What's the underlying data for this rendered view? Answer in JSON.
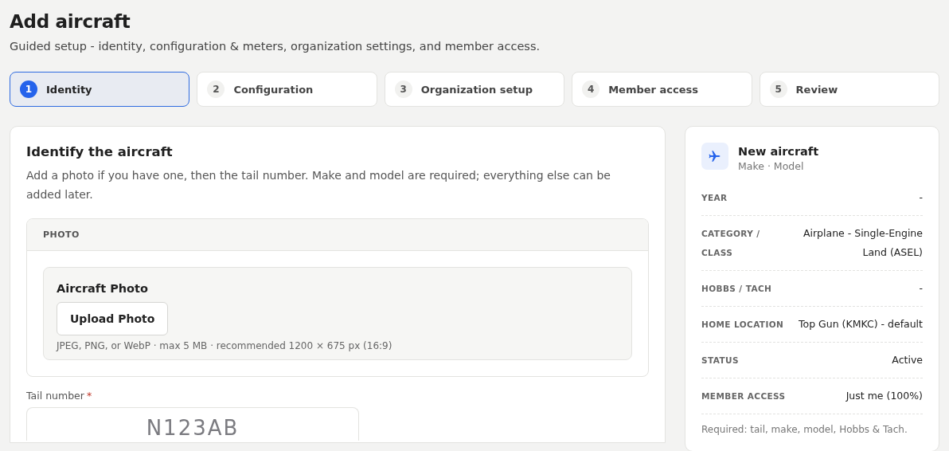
{
  "header": {
    "title": "Add aircraft",
    "subtitle": "Guided setup - identity, configuration & meters, organization settings, and member access."
  },
  "steps": [
    {
      "number": "1",
      "label": "Identity",
      "selected": true
    },
    {
      "number": "2",
      "label": "Configuration",
      "selected": false
    },
    {
      "number": "3",
      "label": "Organization setup",
      "selected": false
    },
    {
      "number": "4",
      "label": "Member access",
      "selected": false
    },
    {
      "number": "5",
      "label": "Review",
      "selected": false
    }
  ],
  "identity": {
    "title": "Identify the aircraft",
    "description": "Add a photo if you have one, then the tail number. Make and model are required; everything else can be added later.",
    "photo_section": {
      "heading": "PHOTO",
      "title": "Aircraft Photo",
      "button": "Upload Photo",
      "hint": "JPEG, PNG, or WebP · max 5 MB · recommended 1200 × 675 px (16:9)"
    },
    "tail_number": {
      "label": "Tail number",
      "required": true,
      "required_mark": "*",
      "placeholder": "N123AB"
    }
  },
  "summary": {
    "title": "New aircraft",
    "subtitle": "Make · Model",
    "rows": [
      {
        "label": "YEAR",
        "value": "-"
      },
      {
        "label": "CATEGORY / CLASS",
        "value": "Airplane - Single-Engine Land (ASEL)"
      },
      {
        "label": "HOBBS / TACH",
        "value": "-"
      },
      {
        "label": "HOME LOCATION",
        "value": "Top Gun (KMKC) - default"
      },
      {
        "label": "STATUS",
        "value": "Active"
      },
      {
        "label": "MEMBER ACCESS",
        "value": "Just me (100%)"
      }
    ],
    "note": "Required: tail, make, model, Hobbs & Tach."
  }
}
